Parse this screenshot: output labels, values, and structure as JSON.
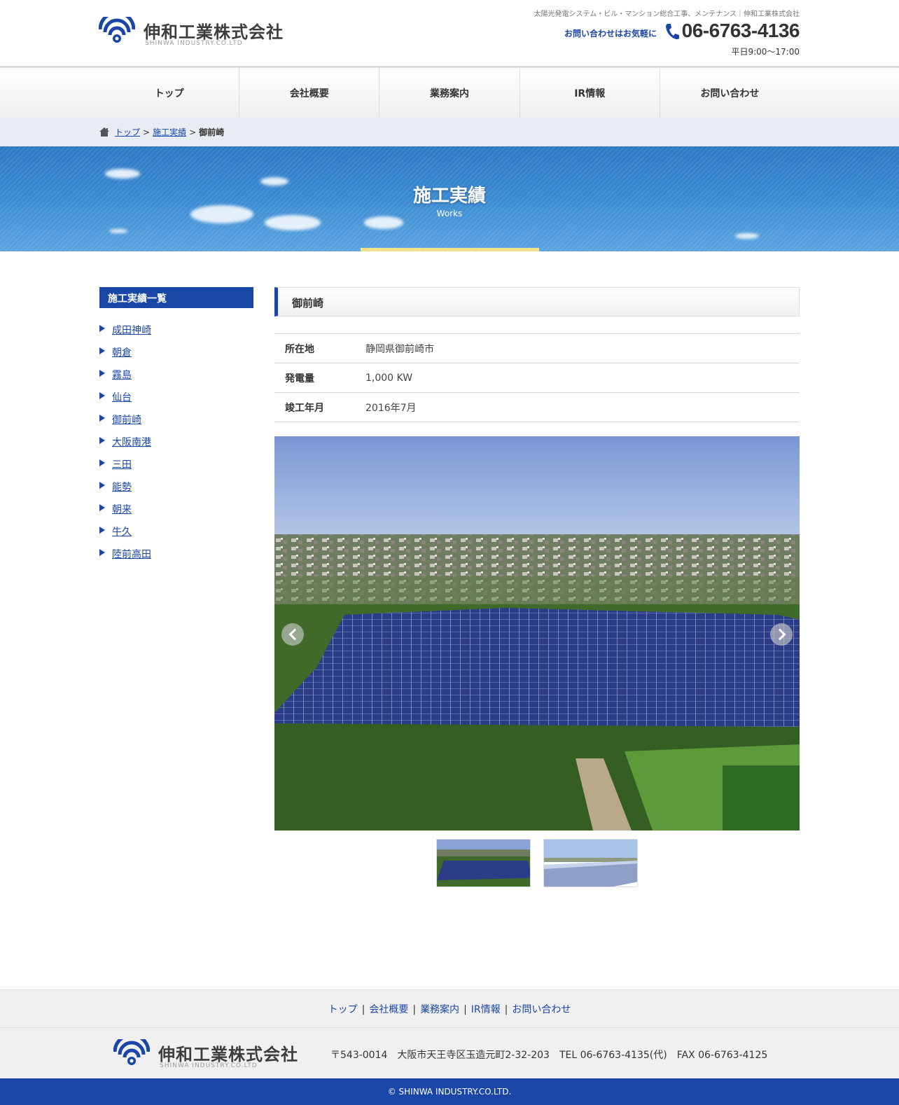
{
  "header": {
    "logo_text": "伸和工業株式会社",
    "logo_sub": "SHINWA INDUSTRY.CO.LTD",
    "tagline": "太陽光発電システム・ビル・マンション総合工事、メンテナンス｜伸和工業株式会社",
    "contact_lead": "お問い合わせはお気軽に",
    "phone": "06-6763-4136",
    "hours": "平日9:00～17:00"
  },
  "nav": {
    "items": [
      "トップ",
      "会社概要",
      "業務案内",
      "IR情報",
      "お問い合わせ"
    ]
  },
  "breadcrumb": {
    "home": "トップ",
    "works": "施工実績",
    "current": "御前崎",
    "separator": ">"
  },
  "hero": {
    "title": "施工実績",
    "subtitle": "Works"
  },
  "sidebar": {
    "heading": "施工実績一覧",
    "items": [
      "成田神崎",
      "朝倉",
      "霧島",
      "仙台",
      "御前崎",
      "大阪南港",
      "三田",
      "能勢",
      "朝来",
      "牛久",
      "陸前高田"
    ]
  },
  "main": {
    "heading": "御前崎",
    "specs": [
      {
        "label": "所在地",
        "value": "静岡県御前崎市"
      },
      {
        "label": "発電量",
        "value": "1,000 KW"
      },
      {
        "label": "竣工年月",
        "value": "2016年7月"
      }
    ]
  },
  "footer": {
    "nav": [
      "トップ",
      "会社概要",
      "業務案内",
      "IR情報",
      "お問い合わせ"
    ],
    "nav_separator": "|",
    "logo_text": "伸和工業株式会社",
    "logo_sub": "SHINWA INDUSTRY.CO.LTD",
    "address": "〒543-0014　大阪市天王寺区玉造元町2-32-203　TEL 06-6763-4135(代)　FAX 06-6763-4125",
    "copyright": "© SHINWA INDUSTRY.CO.LTD."
  },
  "colors": {
    "brand_blue": "#1a46a8",
    "hero_sky": "#3a8ad2",
    "hero_accent": "#f2e28c"
  }
}
